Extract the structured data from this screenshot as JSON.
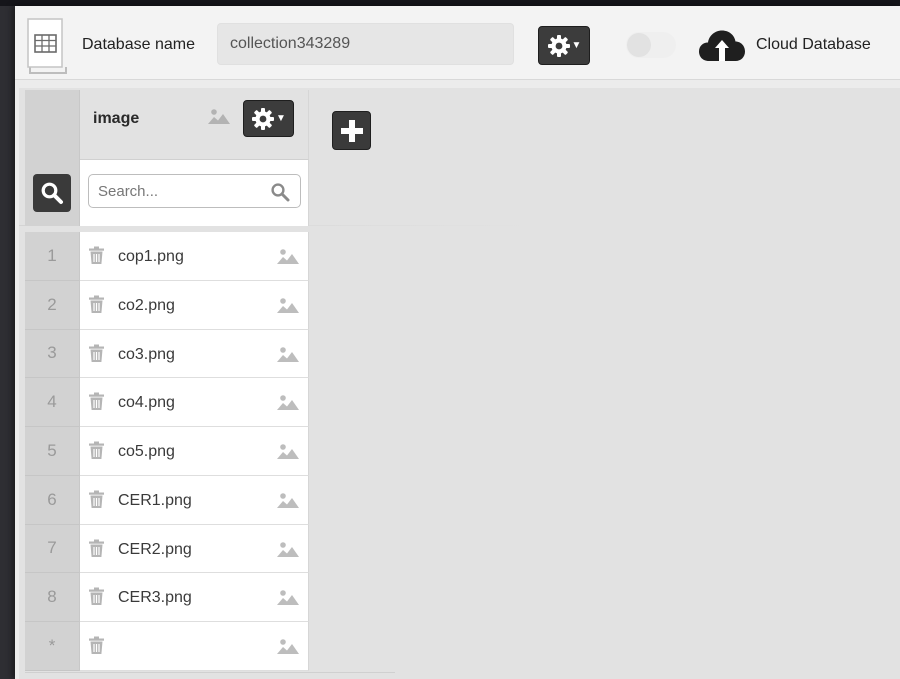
{
  "header": {
    "db_label": "Database name",
    "db_name_value": "collection343289",
    "cloud_label": "Cloud Database",
    "toggle_on": false
  },
  "column": {
    "title": "image",
    "search_placeholder": "Search..."
  },
  "rows": [
    {
      "num": "1",
      "file": "cop1.png"
    },
    {
      "num": "2",
      "file": "co2.png"
    },
    {
      "num": "3",
      "file": "co3.png"
    },
    {
      "num": "4",
      "file": "co4.png"
    },
    {
      "num": "5",
      "file": "co5.png"
    },
    {
      "num": "6",
      "file": "CER1.png"
    },
    {
      "num": "7",
      "file": "CER2.png"
    },
    {
      "num": "8",
      "file": "CER3.png"
    },
    {
      "num": "*",
      "file": ""
    }
  ],
  "icons": {
    "database": "table-document-icon",
    "settings": "gear-icon",
    "cloud": "cloud-upload-icon",
    "search": "search-icon",
    "add": "plus-icon",
    "delete": "trash-icon",
    "image": "image-icon"
  },
  "colors": {
    "button_dark": "#3a3a3a",
    "panel_bg": "#e2e2e2",
    "row_number_bg": "#d2d2d2"
  }
}
